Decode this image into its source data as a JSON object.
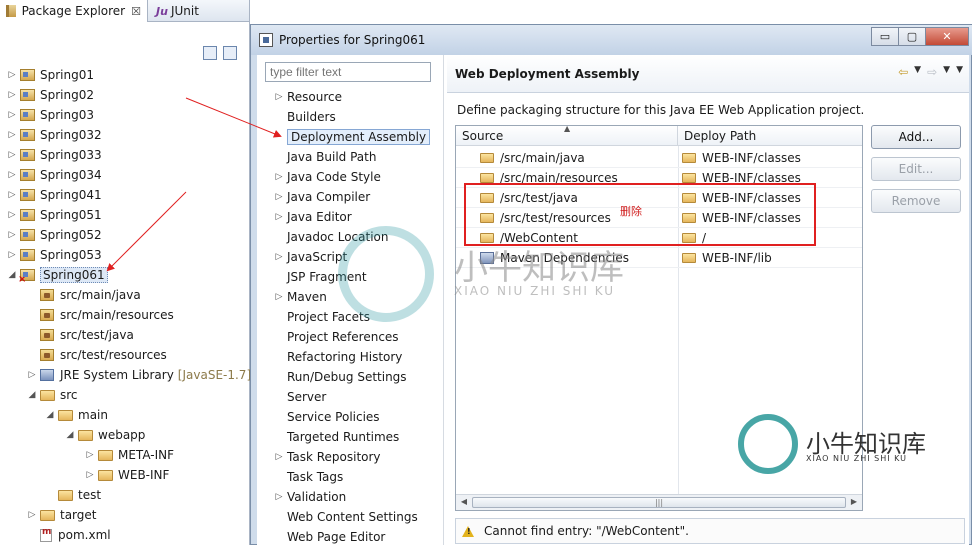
{
  "explorer": {
    "tabs": {
      "package_explorer": "Package Explorer",
      "junit": "JUnit",
      "close_glyph": "☒"
    },
    "tree": [
      {
        "label": "Spring01",
        "kind": "project",
        "toggle": "▷"
      },
      {
        "label": "Spring02",
        "kind": "project",
        "toggle": "▷"
      },
      {
        "label": "Spring03",
        "kind": "project",
        "toggle": "▷"
      },
      {
        "label": "Spring032",
        "kind": "project",
        "toggle": "▷"
      },
      {
        "label": "Spring033",
        "kind": "project",
        "toggle": "▷"
      },
      {
        "label": "Spring034",
        "kind": "project",
        "toggle": "▷"
      },
      {
        "label": "Spring041",
        "kind": "project",
        "toggle": "▷"
      },
      {
        "label": "Spring051",
        "kind": "project",
        "toggle": "▷"
      },
      {
        "label": "Spring052",
        "kind": "project",
        "toggle": "▷"
      },
      {
        "label": "Spring053",
        "kind": "project",
        "toggle": "▷"
      },
      {
        "label": "Spring061",
        "kind": "project-error",
        "toggle": "◢",
        "selected": true
      },
      {
        "label": "src/main/java",
        "kind": "source-folder",
        "toggle": ""
      },
      {
        "label": "src/main/resources",
        "kind": "source-folder",
        "toggle": ""
      },
      {
        "label": "src/test/java",
        "kind": "source-folder",
        "toggle": ""
      },
      {
        "label": "src/test/resources",
        "kind": "source-folder",
        "toggle": ""
      },
      {
        "label": "JRE System Library",
        "suffix": "[JavaSE-1.7]",
        "kind": "library",
        "toggle": "▷"
      },
      {
        "label": "src",
        "kind": "folder",
        "toggle": "◢"
      },
      {
        "label": "main",
        "kind": "folder",
        "toggle": "◢"
      },
      {
        "label": "webapp",
        "kind": "folder",
        "toggle": "◢"
      },
      {
        "label": "META-INF",
        "kind": "folder",
        "toggle": "▷"
      },
      {
        "label": "WEB-INF",
        "kind": "folder",
        "toggle": "▷"
      },
      {
        "label": "test",
        "kind": "folder",
        "toggle": ""
      },
      {
        "label": "target",
        "kind": "folder",
        "toggle": "▷"
      },
      {
        "label": "pom.xml",
        "kind": "xml",
        "toggle": ""
      }
    ]
  },
  "dialog": {
    "title": "Properties for Spring061",
    "window_buttons": {
      "minimize": "▭",
      "maximize": "▢",
      "close": "✕"
    },
    "filter_placeholder": "type filter text",
    "nav": [
      {
        "label": "Resource",
        "toggle": "▷"
      },
      {
        "label": "Builders",
        "toggle": ""
      },
      {
        "label": "Deployment Assembly",
        "toggle": "",
        "selected": true
      },
      {
        "label": "Java Build Path",
        "toggle": ""
      },
      {
        "label": "Java Code Style",
        "toggle": "▷"
      },
      {
        "label": "Java Compiler",
        "toggle": "▷"
      },
      {
        "label": "Java Editor",
        "toggle": "▷"
      },
      {
        "label": "Javadoc Location",
        "toggle": ""
      },
      {
        "label": "JavaScript",
        "toggle": "▷"
      },
      {
        "label": "JSP Fragment",
        "toggle": ""
      },
      {
        "label": "Maven",
        "toggle": "▷"
      },
      {
        "label": "Project Facets",
        "toggle": ""
      },
      {
        "label": "Project References",
        "toggle": ""
      },
      {
        "label": "Refactoring History",
        "toggle": ""
      },
      {
        "label": "Run/Debug Settings",
        "toggle": ""
      },
      {
        "label": "Server",
        "toggle": ""
      },
      {
        "label": "Service Policies",
        "toggle": ""
      },
      {
        "label": "Targeted Runtimes",
        "toggle": ""
      },
      {
        "label": "Task Repository",
        "toggle": "▷"
      },
      {
        "label": "Task Tags",
        "toggle": ""
      },
      {
        "label": "Validation",
        "toggle": "▷"
      },
      {
        "label": "Web Content Settings",
        "toggle": ""
      },
      {
        "label": "Web Page Editor",
        "toggle": ""
      }
    ],
    "page": {
      "title": "Web Deployment Assembly",
      "nav_back": "⇦",
      "nav_forward": "⇨",
      "nav_menu": "▼",
      "description": "Define packaging structure for this Java EE Web Application project.",
      "columns": {
        "source": "Source",
        "deploy_path": "Deploy Path"
      },
      "rows": [
        {
          "source": "/src/main/java",
          "deploy": "WEB-INF/classes",
          "icon": "folder"
        },
        {
          "source": "/src/main/resources",
          "deploy": "WEB-INF/classes",
          "icon": "folder"
        },
        {
          "source": "/src/test/java",
          "deploy": "WEB-INF/classes",
          "icon": "folder"
        },
        {
          "source": "/src/test/resources",
          "deploy": "WEB-INF/classes",
          "icon": "folder"
        },
        {
          "source": "/WebContent",
          "deploy": "/",
          "icon": "folder"
        },
        {
          "source": "Maven Dependencies",
          "deploy": "WEB-INF/lib",
          "icon": "library"
        }
      ],
      "buttons": {
        "add": "Add...",
        "edit": "Edit...",
        "remove": "Remove"
      },
      "scroll": {
        "left": "◀",
        "right": "▶",
        "thumb_grip": "|||"
      },
      "status": "Cannot find entry: \"/WebContent\"."
    }
  },
  "annotation": {
    "label": "删除",
    "color": "#e02020"
  },
  "watermark": {
    "brand": "小牛知识库",
    "sub": "XIAO NIU ZHI SHI KU"
  }
}
